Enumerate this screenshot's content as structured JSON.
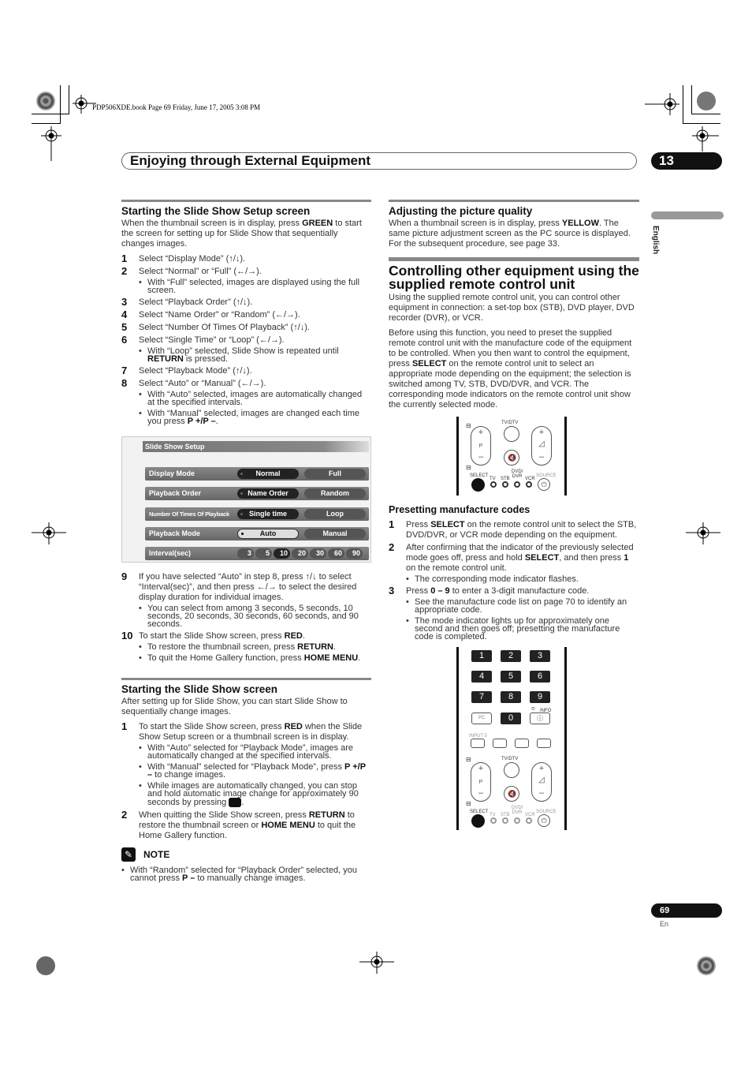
{
  "book_info": "PDP506XDE.book  Page 69  Friday, June 17, 2005  3:08 PM",
  "chapter": {
    "title": "Enjoying through External Equipment",
    "number": "13"
  },
  "side_tab": {
    "language": "English"
  },
  "footer": {
    "page": "69",
    "lang": "En"
  },
  "left": {
    "setup_section": {
      "heading": "Starting the Slide Show Setup screen",
      "intro_pre": "When the thumbnail screen is in display, press ",
      "intro_key": "GREEN",
      "intro_post": " to start the screen for setting up for Slide Show that sequentially changes images.",
      "steps": [
        {
          "num": "1",
          "text": "Select “Display Mode” (↑/↓)."
        },
        {
          "num": "2",
          "text": "Select “Normal” or “Full” (←/→).",
          "bullets": [
            "With “Full” selected, images are displayed using the full screen."
          ]
        },
        {
          "num": "3",
          "text": "Select “Playback Order” (↑/↓)."
        },
        {
          "num": "4",
          "text": "Select “Name Order” or “Random” (←/→)."
        },
        {
          "num": "5",
          "text": "Select “Number Of Times Of Playback” (↑/↓)."
        },
        {
          "num": "6",
          "text": "Select “Single Time” or “Loop” (←/→)."
        },
        {
          "num": "7",
          "text": "Select “Playback Mode” (↑/↓)."
        },
        {
          "num": "8",
          "text": "Select “Auto” or “Manual” (←/→)."
        }
      ],
      "step6_bullet_pre": "With “Loop” selected, Slide Show is repeated until ",
      "step6_bullet_key": "RETURN",
      "step6_bullet_post": " is pressed.",
      "step8_bullet1": "With “Auto” selected, images are automatically changed at the specified intervals.",
      "step8_bullet2_pre": "With “Manual” selected, images are changed each time you press ",
      "step8_bullet2_key": "P +/P –",
      "step8_bullet2_post": "."
    },
    "osd": {
      "title": "Slide Show Setup",
      "rows": [
        {
          "label": "Display Mode",
          "options": [
            "Normal",
            "Full"
          ],
          "selected": "Normal"
        },
        {
          "label": "Playback Order",
          "options": [
            "Name Order",
            "Random"
          ],
          "selected": "Name Order"
        },
        {
          "label": "Number Of Times Of Playback",
          "options": [
            "Single time",
            "Loop"
          ],
          "selected": "Single time"
        },
        {
          "label": "Playback Mode",
          "options": [
            "Auto",
            "Manual"
          ],
          "selected": "Auto"
        }
      ],
      "interval": {
        "label": "Interval(sec)",
        "options": [
          "3",
          "5",
          "10",
          "20",
          "30",
          "60",
          "90"
        ],
        "selected": "10"
      }
    },
    "steps_after": {
      "step9_num": "9",
      "step9_text": "If you have selected “Auto” in step 8, press ↑/↓ to select “Interval(sec)”, and then press ←/→ to select the desired display duration for individual images.",
      "step9_bullet": "You can select from among 3 seconds, 5 seconds, 10 seconds, 20 seconds, 30 seconds, 60 seconds, and 90 seconds.",
      "step10_num": "10",
      "step10_pre": "To start the Slide Show screen, press ",
      "step10_key": "RED",
      "step10_post": ".",
      "step10_b1_pre": "To restore the thumbnail screen, press ",
      "step10_b1_key": "RETURN",
      "step10_b2_pre": "To quit the Home Gallery function, press ",
      "step10_b2_key": "HOME MENU"
    },
    "slideshow_section": {
      "heading": "Starting the Slide Show screen",
      "intro": "After setting up for Slide Show, you can start Slide Show to sequentially change images.",
      "step1_num": "1",
      "step1_pre": "To start the Slide Show screen, press ",
      "step1_key": "RED",
      "step1_post": " when the Slide Show Setup screen or a thumbnail screen is in display.",
      "b1": "With “Auto” selected for “Playback Mode”, images are automatically changed at the specified intervals.",
      "b2_pre": "With “Manual” selected for “Playback Mode”, press ",
      "b2_key": "P +/P –",
      "b2_post": " to change images.",
      "b3": "While images are automatically changed, you can stop and hold automatic image change for approximately 90 seconds by pressing ",
      "step2_num": "2",
      "step2_pre": "When quitting the Slide Show screen, press ",
      "step2_key1": "RETURN",
      "step2_mid": " to restore the thumbnail screen or ",
      "step2_key2": "HOME MENU",
      "step2_post": " to quit the Home Gallery function."
    },
    "note": {
      "title": "NOTE",
      "pre": "With “Random” selected for “Playback Order” selected, you cannot press ",
      "key": "P –",
      "post": " to manually change images."
    }
  },
  "right": {
    "picture_section": {
      "heading": "Adjusting the picture quality",
      "pre": "When a thumbnail screen is in display, press ",
      "key": "YELLOW",
      "post": ". The same picture adjustment screen as the PC source is displayed. For the subsequent procedure, see page 33."
    },
    "control_section": {
      "heading": "Controlling other equipment using the supplied remote control unit",
      "p1": "Using the supplied remote control unit, you can control other equipment in connection: a set-top box (STB), DVD player, DVD recorder (DVR), or VCR.",
      "p2_pre": "Before using this function, you need to preset the supplied remote control unit with the manufacture code of the equipment to be controlled. When you then want to control the equipment, press ",
      "p2_key": "SELECT",
      "p2_post": " on the remote control unit to select an appropriate mode depending on the equipment; the selection is switched among TV, STB, DVD/DVR, and VCR. The corresponding mode indicators on the remote control unit show the currently selected mode."
    },
    "remote_labels": {
      "tvdtv": "TV/DTV",
      "p": "P",
      "plus": "+",
      "minus": "–",
      "select": "SELECT",
      "tv": "TV",
      "stb": "STB",
      "dvd": "DVD/ DVR",
      "vcr": "VCR",
      "source": "SOURCE",
      "pc": "PC",
      "info": "INFO",
      "input5": "INPUT 5",
      "keys": [
        "1",
        "2",
        "3",
        "4",
        "5",
        "6",
        "7",
        "8",
        "9",
        "0"
      ]
    },
    "preset_section": {
      "heading": "Presetting manufacture codes",
      "s1_num": "1",
      "s1_pre": "Press ",
      "s1_key": "SELECT",
      "s1_post": " on the remote control unit to select the STB, DVD/DVR, or VCR mode depending on the equipment.",
      "s2_num": "2",
      "s2_pre": "After confirming that the indicator of the previously selected mode goes off, press and hold ",
      "s2_key": "SELECT",
      "s2_mid": ", and then press ",
      "s2_key2": "1",
      "s2_post": " on the remote control unit.",
      "s2_bullet": "The corresponding mode indicator flashes.",
      "s3_num": "3",
      "s3_pre": "Press ",
      "s3_key": "0 – 9",
      "s3_post": " to enter a 3-digit manufacture code.",
      "s3_b1": "See the manufacture code list on page 70 to identify an appropriate code.",
      "s3_b2": "The mode indicator lights up for approximately one second and then goes off; presetting the manufacture code is completed."
    }
  }
}
